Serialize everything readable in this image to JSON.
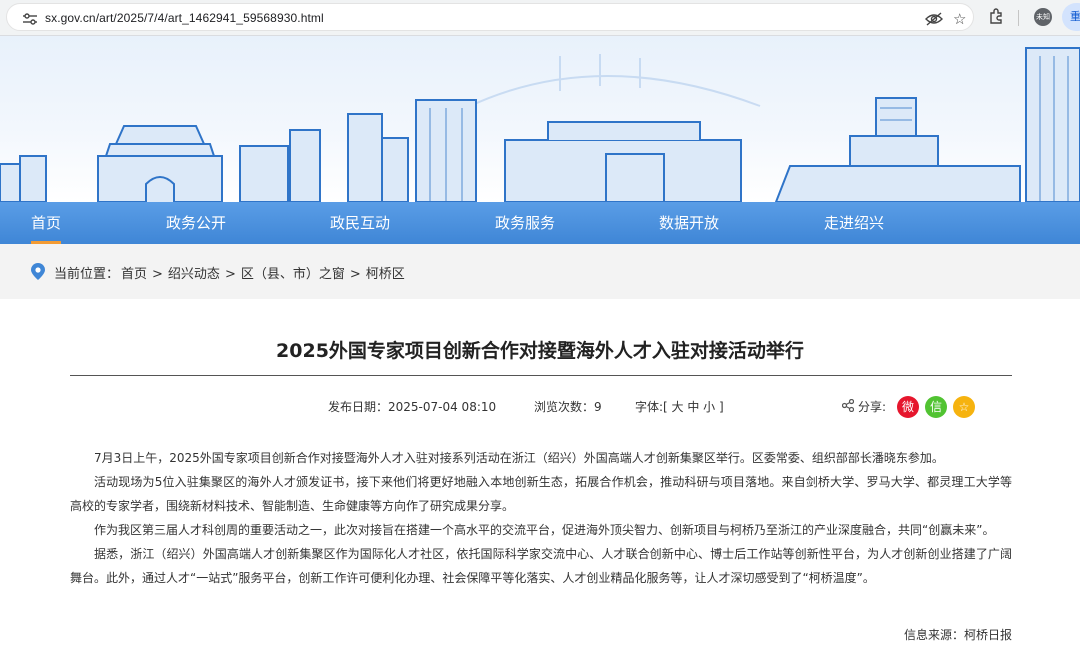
{
  "browser": {
    "url": "sx.gov.cn/art/2025/7/4/art_1462941_59568930.html",
    "profile_label": "未知",
    "profile2_label": "重"
  },
  "nav": {
    "items": [
      "首页",
      "政务公开",
      "政民互动",
      "政务服务",
      "数据开放",
      "走进绍兴"
    ],
    "active_index": 0,
    "accent": "#f39b33"
  },
  "breadcrumb": {
    "label": "当前位置：",
    "items": [
      "首页",
      "绍兴动态",
      "区（县、市）之窗",
      "柯桥区"
    ],
    "separator": ">"
  },
  "article": {
    "title": "2025外国专家项目创新合作对接暨海外人才入驻对接活动举行",
    "meta": {
      "date": "发布日期：2025-07-04 08:10",
      "views": "浏览次数：9",
      "font_label": "字体:[ 大 中 小 ]"
    },
    "share_label": "分享:",
    "share_buttons": [
      {
        "name": "weibo",
        "color": "#e6162d",
        "glyph": "微"
      },
      {
        "name": "wechat",
        "color": "#51c332",
        "glyph": "信"
      },
      {
        "name": "qzone",
        "color": "#f6b30f",
        "glyph": "☆"
      }
    ],
    "paragraphs": [
      "7月3日上午，2025外国专家项目创新合作对接暨海外人才入驻对接系列活动在浙江（绍兴）外国高端人才创新集聚区举行。区委常委、组织部部长潘晓东参加。",
      "活动现场为5位入驻集聚区的海外人才颁发证书，接下来他们将更好地融入本地创新生态，拓展合作机会，推动科研与项目落地。来自剑桥大学、罗马大学、都灵理工大学等高校的专家学者，围绕新材料技术、智能制造、生命健康等方向作了研究成果分享。",
      "作为我区第三届人才科创周的重要活动之一，此次对接旨在搭建一个高水平的交流平台，促进海外顶尖智力、创新项目与柯桥乃至浙江的产业深度融合，共同“创赢未来”。",
      "据悉，浙江（绍兴）外国高端人才创新集聚区作为国际化人才社区，依托国际科学家交流中心、人才联合创新中心、博士后工作站等创新性平台，为人才创新创业搭建了广阔舞台。此外，通过人才“一站式”服务平台，创新工作许可便利化办理、社会保障平等化落实、人才创业精品化服务等，让人才深切感受到了“柯桥温度”。"
    ],
    "source": "信息来源：柯桥日报"
  }
}
